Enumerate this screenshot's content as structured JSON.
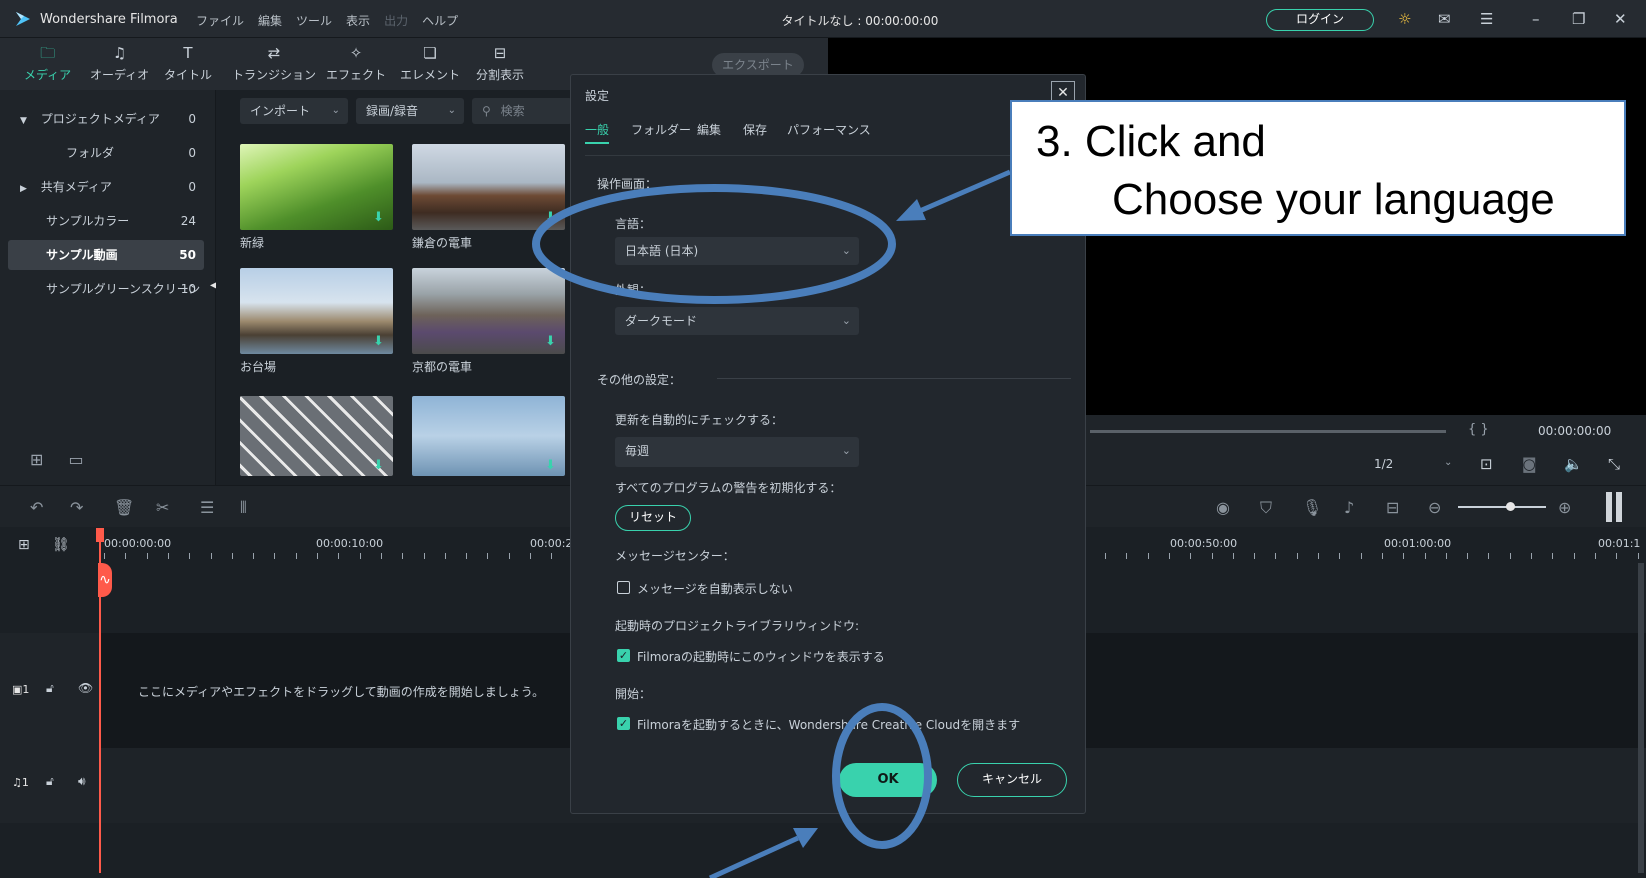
{
  "titlebar": {
    "app_name": "Wondershare Filmora",
    "menus": [
      "ファイル",
      "編集",
      "ツール",
      "表示",
      "出力",
      "ヘルプ"
    ],
    "window_title": "タイトルなし : 00:00:00:00",
    "login_label": "ログイン"
  },
  "toolbar": {
    "tools": [
      "メディア",
      "オーディオ",
      "タイトル",
      "トランジション",
      "エフェクト",
      "エレメント",
      "分割表示"
    ],
    "export_label": "エクスポート"
  },
  "left_panel": {
    "items": [
      {
        "label": "プロジェクトメディア",
        "count": "0"
      },
      {
        "label": "フォルダ",
        "count": "0"
      },
      {
        "label": "共有メディア",
        "count": "0"
      },
      {
        "label": "サンプルカラー",
        "count": "24"
      },
      {
        "label": "サンプル動画",
        "count": "50"
      },
      {
        "label": "サンプルグリーンスクリーン",
        "count": "10"
      }
    ]
  },
  "media": {
    "import_label": "インポート",
    "record_label": "録画/録音",
    "search_placeholder": "検索",
    "thumbs": [
      "新緑",
      "鎌倉の電車",
      "お台場",
      "京都の電車"
    ]
  },
  "preview": {
    "brackets": "{    }",
    "time": "00:00:00:00",
    "zoom": "1/2"
  },
  "timeline": {
    "ruler": [
      "00:00:00:00",
      "00:00:10:00",
      "00:00:2",
      "00:00:50:00",
      "00:01:00:00",
      "00:01:1"
    ],
    "video_track_label": "1",
    "audio_track_label": "1",
    "drop_hint": "ここにメディアやエフェクトをドラッグして動画の作成を開始しましょう。"
  },
  "dialog": {
    "title": "設定",
    "tabs": [
      "一般",
      "フォルダー",
      "編集",
      "保存",
      "パフォーマンス"
    ],
    "section_ui": "操作画面：",
    "language_label": "言語：",
    "language_value": "日本語 (日本)",
    "theme_label": "外観：",
    "theme_value": "ダークモード",
    "section_other": "その他の設定：",
    "update_label": "更新を自動的にチェックする：",
    "update_value": "毎週",
    "reset_warn_label": "すべてのプログラムの警告を初期化する：",
    "reset_label": "リセット",
    "message_center_label": "メッセージセンター：",
    "message_checkbox": "メッセージを自動表示しない",
    "project_library_label": "起動時のプロジェクトライブラリウィンドウ:",
    "project_library_checkbox": "Filmoraの起動時にこのウィンドウを表示する",
    "start_label": "開始：",
    "start_checkbox": "Filmoraを起動するときに、Wondershare Creative Cloudを開きます",
    "ok_label": "OK",
    "cancel_label": "キャンセル"
  },
  "annotation": {
    "line1": "3. Click and",
    "line2": "Choose your language"
  },
  "colors": {
    "accent": "#39d2ad",
    "annotation_blue": "#4a7ebb",
    "playhead": "#ff5a4a"
  }
}
